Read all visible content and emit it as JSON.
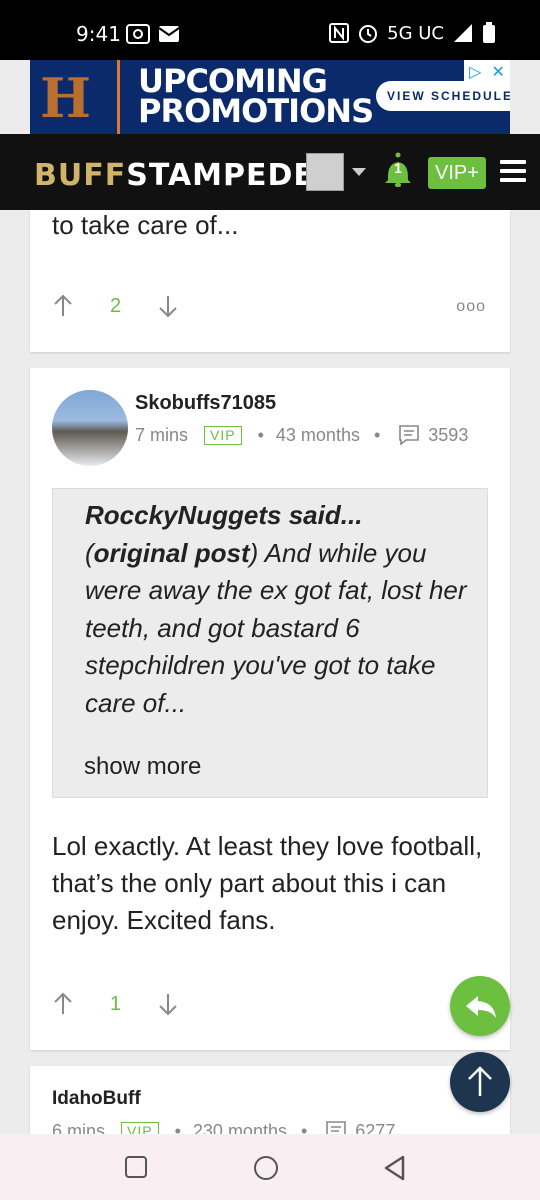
{
  "status_bar": {
    "time": "9:41",
    "network": "5G UC"
  },
  "ad": {
    "logo_letter": "H",
    "title_line1": "UPCOMING",
    "title_line2": "PROMOTIONS",
    "button_label": "VIEW SCHEDULE"
  },
  "nav": {
    "logo_part1": "BUFF",
    "logo_part2": "STAMPEDE",
    "notification_count": "1",
    "vip_label": "VIP+"
  },
  "posts": [
    {
      "text_tail": "to take care of...",
      "vote_count": "2",
      "more_label": "ooo"
    },
    {
      "username": "Skobuffs71085",
      "time_ago": "7 mins",
      "badge": "VIP",
      "tenure": "43 months",
      "post_count": "3593",
      "quote_author": "RocckyNuggets said...",
      "quote_ref": "original post",
      "quote_body": " And while you were away the ex got fat, lost her teeth, and got bastard 6 stepchildren you've got to take care of...",
      "show_more": "show more",
      "body": "Lol exactly. At least they love football, that’s the only part about this i can enjoy. Excited fans.",
      "vote_count": "1"
    },
    {
      "username": "IdahoBuff",
      "time_ago": "6 mins",
      "badge": "VIP",
      "tenure": "230 months",
      "post_count": "6277"
    }
  ],
  "colors": {
    "accent_green": "#6cbf3f",
    "navy": "#1e3550",
    "ad_blue": "#0a2a6b",
    "ad_orange": "#d97a26"
  }
}
